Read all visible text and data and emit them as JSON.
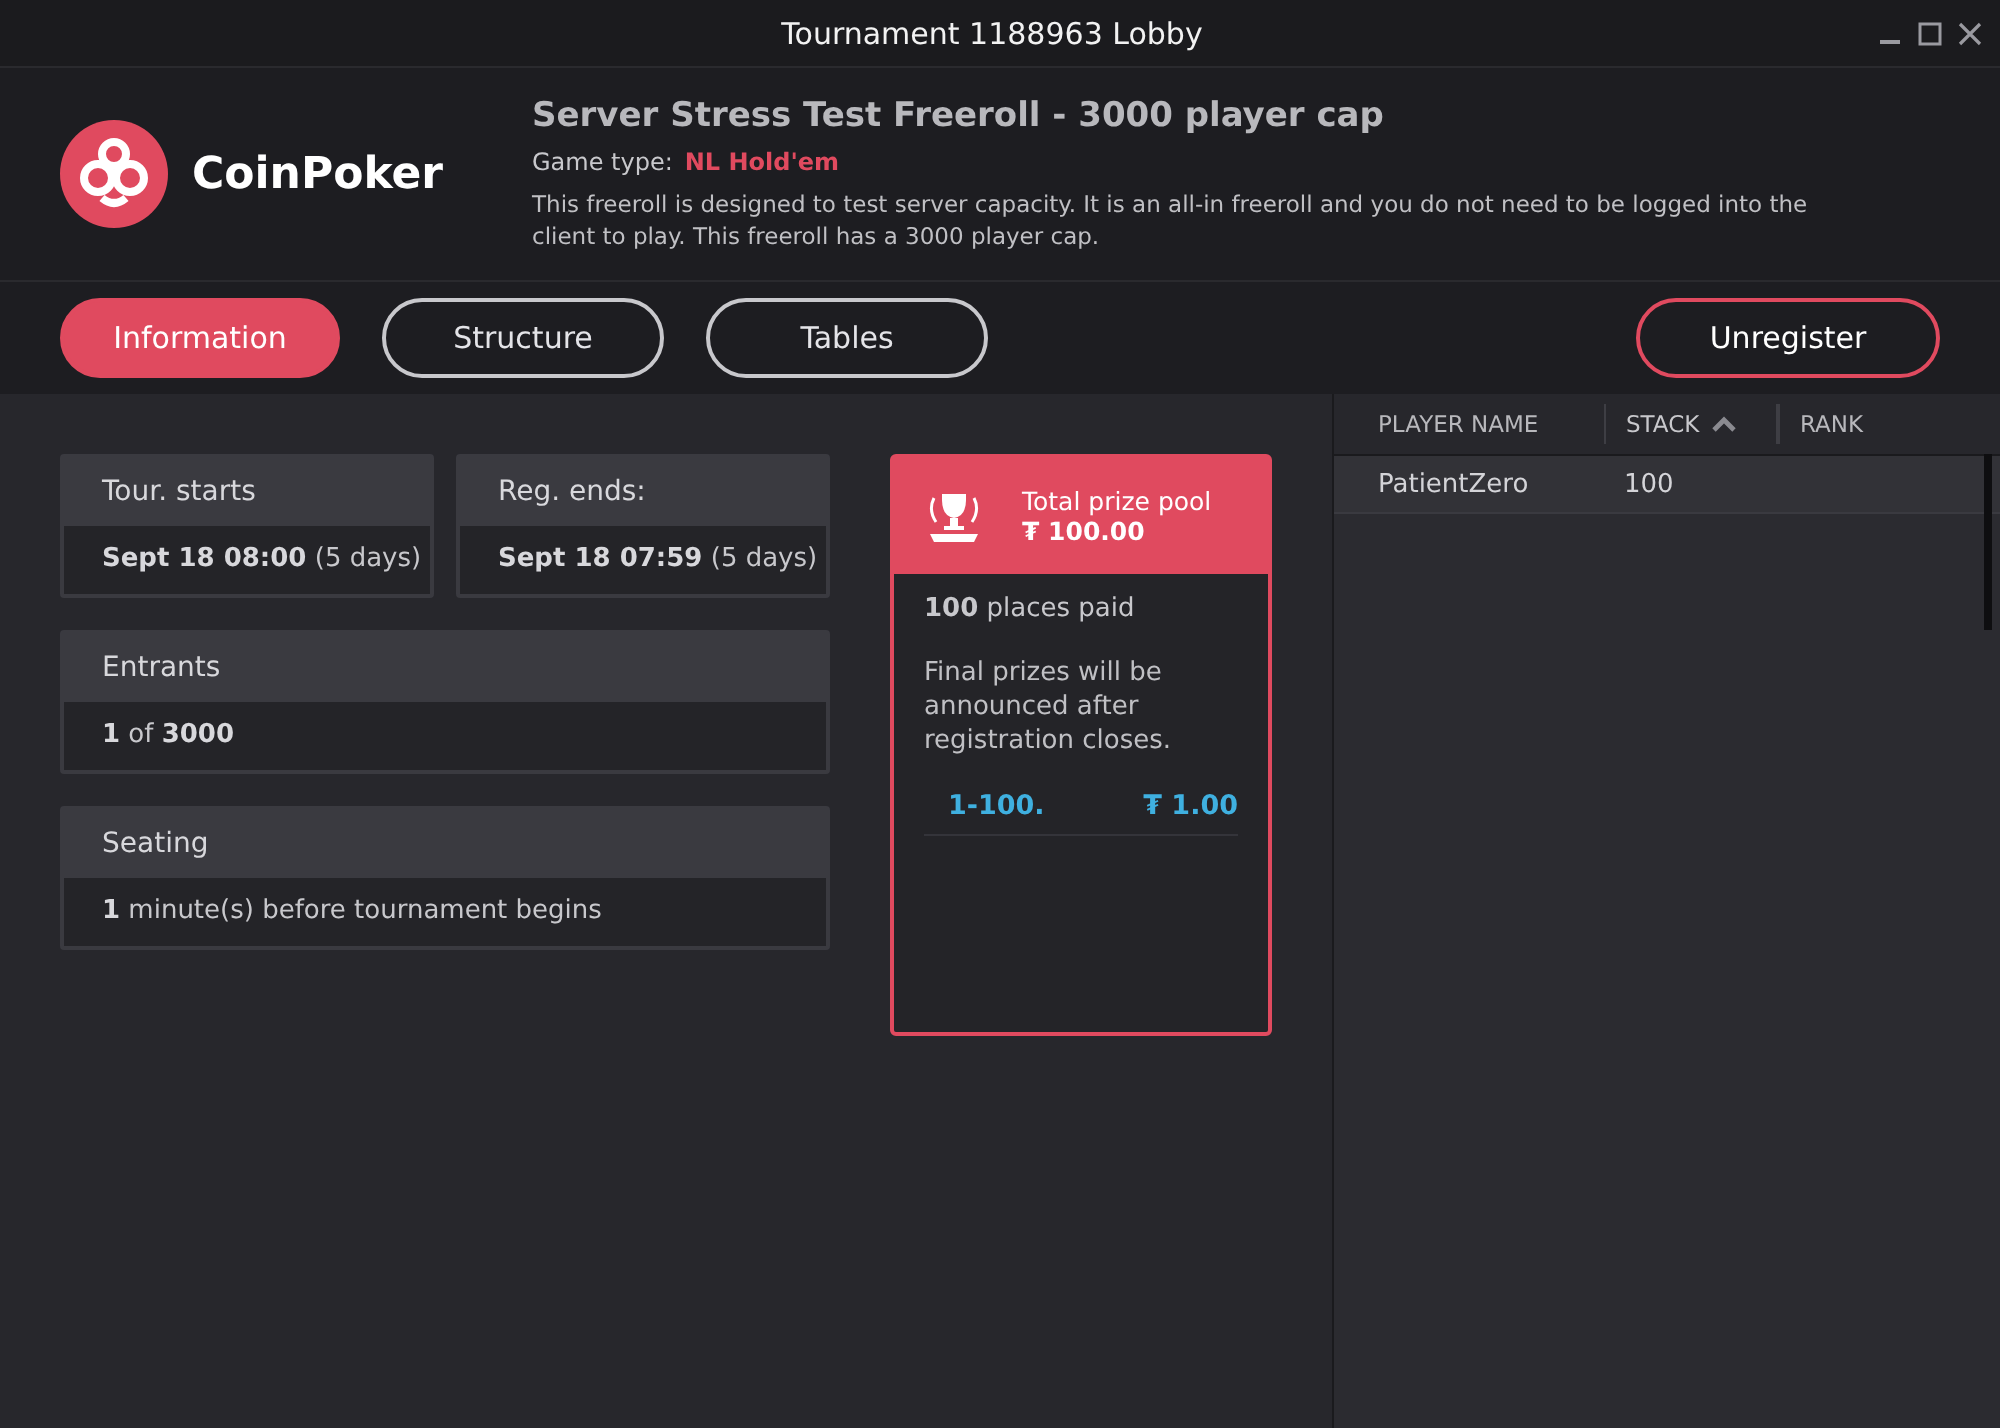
{
  "window": {
    "title": "Tournament 1188963 Lobby"
  },
  "header": {
    "logo_text": "CoinPoker",
    "title": "Server Stress Test Freeroll - 3000 player cap",
    "game_type_label": "Game type:",
    "game_type": "NL Hold'em",
    "description": "This freeroll is designed to test server capacity. It is an all-in freeroll and you do not need to be logged into the client to play. This freeroll has a 3000 player cap."
  },
  "tabs": [
    {
      "label": "Information",
      "selected": true
    },
    {
      "label": "Structure",
      "selected": false
    },
    {
      "label": "Tables",
      "selected": false
    }
  ],
  "unregister_button": "Unregister",
  "info_cards": [
    {
      "title": "Tour. starts",
      "value": "**Sept 18 08:00** (5 days)"
    },
    {
      "title": "Reg. ends:",
      "value": "**Sept 18 07:59** (5 days)"
    },
    {
      "title": "Entrants",
      "value": "**1** of **3000**"
    },
    {
      "title": "Seating",
      "value": "**1** minute(s) before tournament begins"
    }
  ],
  "prize_pool": {
    "label": "Total prize pool",
    "amount": "₮ 100.00",
    "places_paid": "**100** places paid",
    "note": "Final prizes will be announced after registration closes.",
    "payouts": [
      {
        "places": "1-100.",
        "prize": "₮ 1.00"
      }
    ]
  },
  "players_table": {
    "columns": [
      {
        "label": "PLAYER NAME",
        "sorted": false
      },
      {
        "label": "STACK",
        "sorted": true
      },
      {
        "label": "RANK",
        "sorted": false
      }
    ],
    "rows": [
      [
        "PatientZero",
        "100",
        ""
      ]
    ]
  }
}
